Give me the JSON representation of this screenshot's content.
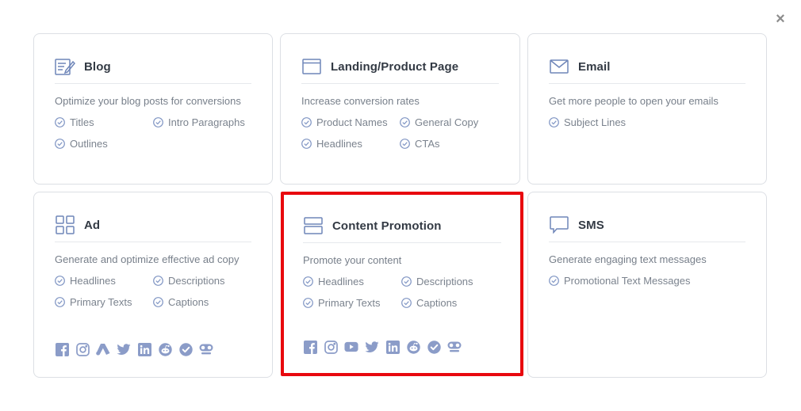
{
  "colors": {
    "icon": "#6f86b9",
    "check": "#8196c4",
    "highlight": "#e8080e"
  },
  "close": {
    "glyph": "×",
    "icon": "close-icon"
  },
  "cards": {
    "blog": {
      "title": "Blog",
      "icon": "blog-edit-icon",
      "description": "Optimize your blog posts for conversions",
      "features": [
        "Titles",
        "Intro Paragraphs",
        "Outlines"
      ]
    },
    "landing": {
      "title": "Landing/Product Page",
      "icon": "browser-window-icon",
      "description": "Increase conversion rates",
      "features": [
        "Product Names",
        "General Copy",
        "Headlines",
        "CTAs"
      ]
    },
    "email": {
      "title": "Email",
      "icon": "envelope-icon",
      "description": "Get more people to open your emails",
      "features": [
        "Subject Lines"
      ]
    },
    "ad": {
      "title": "Ad",
      "icon": "grid-icon",
      "description": "Generate and optimize effective ad copy",
      "features": [
        "Headlines",
        "Descriptions",
        "Primary Texts",
        "Captions"
      ],
      "socials": [
        "facebook-icon",
        "instagram-icon",
        "google-ads-icon",
        "twitter-icon",
        "linkedin-icon",
        "reddit-icon",
        "verified-icon",
        "quora-icon"
      ]
    },
    "content": {
      "title": "Content Promotion",
      "icon": "layout-panels-icon",
      "description": "Promote your content",
      "features": [
        "Headlines",
        "Descriptions",
        "Primary Texts",
        "Captions"
      ],
      "highlighted": true,
      "socials": [
        "facebook-icon",
        "instagram-icon",
        "youtube-icon",
        "twitter-icon",
        "linkedin-icon",
        "reddit-icon",
        "verified-icon",
        "quora-icon"
      ]
    },
    "sms": {
      "title": "SMS",
      "icon": "chat-bubble-icon",
      "description": "Generate engaging text messages",
      "features": [
        "Promotional Text Messages"
      ]
    }
  }
}
